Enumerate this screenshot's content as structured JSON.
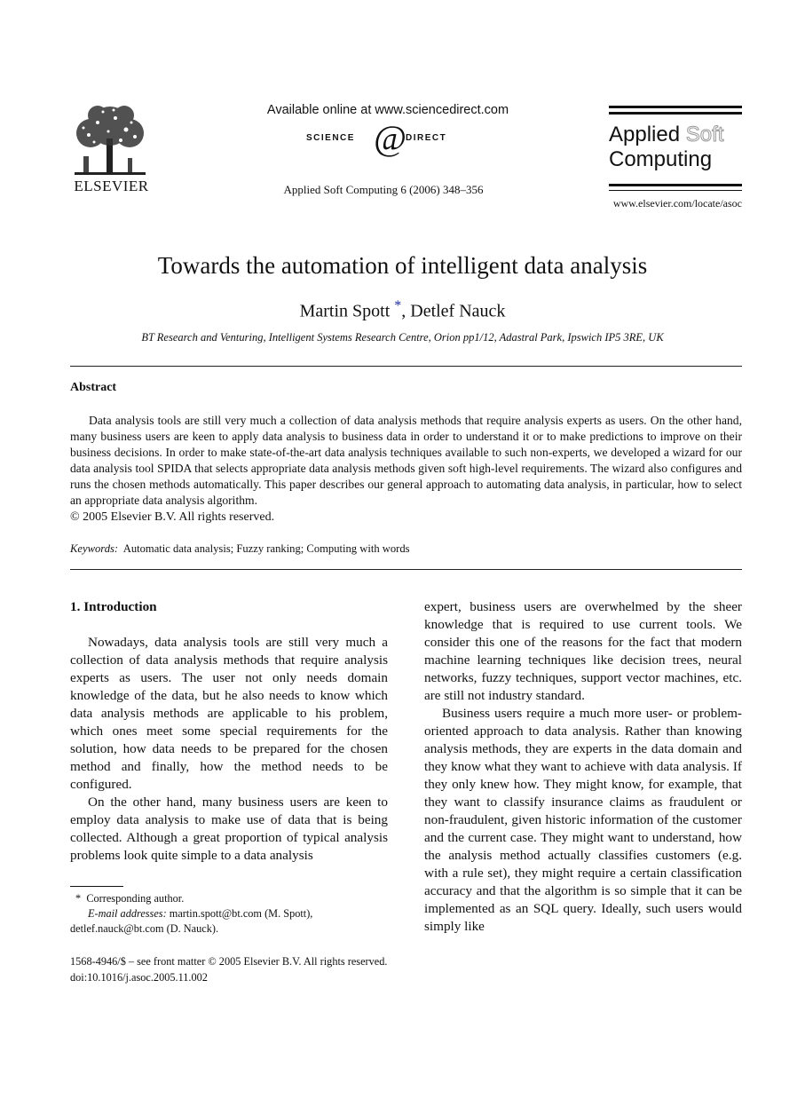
{
  "header": {
    "publisher_logo": "elsevier-tree-logo",
    "publisher_name": "ELSEVIER",
    "available_online": "Available online at www.sciencedirect.com",
    "sciencedirect_left": "SCIENCE",
    "sciencedirect_at": "d",
    "sciencedirect_right": "DIRECT",
    "journal_citation": "Applied Soft Computing 6 (2006) 348–356",
    "journal_name_line1_a": "Applied",
    "journal_name_line1_b": "Soft",
    "journal_name_line2": "Computing",
    "journal_url": "www.elsevier.com/locate/asoc"
  },
  "article": {
    "title": "Towards the automation of intelligent data analysis",
    "author1": "Martin Spott",
    "author_marker": "*",
    "author_sep": ", ",
    "author2": "Detlef Nauck",
    "affiliation": "BT Research and Venturing, Intelligent Systems Research Centre, Orion pp1/12, Adastral Park, Ipswich IP5 3RE, UK"
  },
  "abstract": {
    "heading": "Abstract",
    "text": "Data analysis tools are still very much a collection of data analysis methods that require analysis experts as users. On the other hand, many business users are keen to apply data analysis to business data in order to understand it or to make predictions to improve on their business decisions. In order to make state-of-the-art data analysis techniques available to such non-experts, we developed a wizard for our data analysis tool SPIDA that selects appropriate data analysis methods given soft high-level requirements. The wizard also configures and runs the chosen methods automatically. This paper describes our general approach to automating data analysis, in particular, how to select an appropriate data analysis algorithm.",
    "copyright": "© 2005 Elsevier B.V. All rights reserved."
  },
  "keywords": {
    "label": "Keywords:",
    "value": "Automatic data analysis; Fuzzy ranking; Computing with words"
  },
  "section1": {
    "heading": "1.  Introduction",
    "left_paragraphs": [
      "Nowadays, data analysis tools are still very much a collection of data analysis methods that require analysis experts as users. The user not only needs domain knowledge of the data, but he also needs to know which data analysis methods are applicable to his problem, which ones meet some special requirements for the solution, how data needs to be prepared for the chosen method and finally, how the method needs to be configured.",
      "On the other hand, many business users are keen to employ data analysis to make use of data that is being collected. Although a great proportion of typical analysis problems look quite simple to a data analysis"
    ],
    "right_continuation": "expert, business users are overwhelmed by the sheer knowledge that is required to use current tools. We consider this one of the reasons for the fact that modern machine learning techniques like decision trees, neural networks, fuzzy techniques, support vector machines, etc. are still not industry standard.",
    "right_paragraphs": [
      "Business users require a much more user- or problem-oriented approach to data analysis. Rather than knowing analysis methods, they are experts in the data domain and they know what they want to achieve with data analysis. If they only knew how. They might know, for example, that they want to classify insurance claims as fraudulent or non-fraudulent, given historic information of the customer and the current case. They might want to understand, how the analysis method actually classifies customers (e.g. with a rule set), they might require a certain classification accuracy and that the algorithm is so simple that it can be implemented as an SQL query. Ideally, such users would simply like"
    ]
  },
  "footnote": {
    "marker": "*",
    "corresponding": "Corresponding author.",
    "email_label": "E-mail addresses:",
    "email1": "martin.spott@bt.com (M. Spott),",
    "email2": "detlef.nauck@bt.com (D. Nauck)."
  },
  "bottom": {
    "issn_line": "1568-4946/$ – see front matter © 2005 Elsevier B.V. All rights reserved.",
    "doi": "doi:10.1016/j.asoc.2005.11.002"
  }
}
